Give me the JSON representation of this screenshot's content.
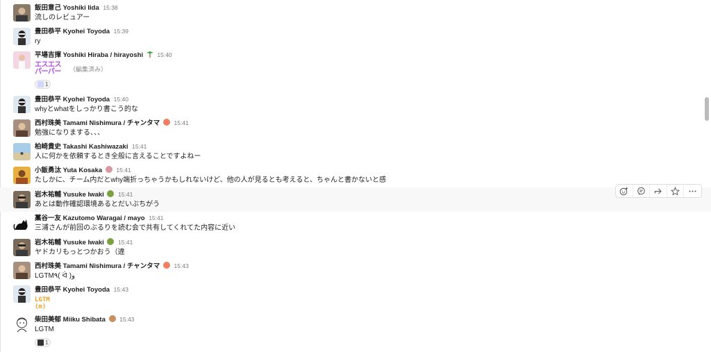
{
  "messages": [
    {
      "name": "飯田意己 Yoshiki Iida",
      "emoji": "",
      "time": "15:38",
      "text": "流しのレビュアー"
    },
    {
      "name": "豊田恭平 Kyohei Toyoda",
      "emoji": "",
      "time": "15:39",
      "text": "ry"
    },
    {
      "name": "平場吉揮 Yoshiki Hiraba / hirayoshi",
      "emoji": "palm-tree",
      "time": "15:40",
      "custom_emoji_lines": [
        "エスエス",
        "パーパー"
      ],
      "edited_label": "（編集済み）",
      "reaction_count": "1"
    },
    {
      "name": "豊田恭平 Kyohei Toyoda",
      "emoji": "",
      "time": "15:40",
      "text": "whyとwhatをしっかり書こう的な"
    },
    {
      "name": "西村珠美 Tamami Nishimura / チャンタマ",
      "emoji": "shrimp",
      "time": "15:41",
      "text": "勉強になりまする、、、"
    },
    {
      "name": "柏崎貴史 Takashi Kashiwazaki",
      "emoji": "",
      "time": "15:41",
      "text": "人に何かを依頼するとき全般に言えることですよねー"
    },
    {
      "name": "小飯勇汰 Yuta Kosaka",
      "emoji": "person",
      "time": "15:41",
      "text": "たしかに、チーム内だとwhy端折っちゃうかもしれないけど、他の人が見るとも考えると、ちゃんと書かないと感"
    },
    {
      "name": "岩木祐輔 Yusuke Iwaki",
      "emoji": "dinosaur",
      "time": "15:41",
      "text": "あとは動作確認環境あるとだいぶちがう"
    },
    {
      "name": "藁谷一友 Kazutomo Waragai / mayo",
      "emoji": "",
      "time": "15:41",
      "text": "三浦さんが前回のぶるりを読む会で共有してくれてた内容に近い"
    },
    {
      "name": "岩木祐輔 Yusuke Iwaki",
      "emoji": "dinosaur",
      "time": "15:41",
      "text": "ヤドカリもっとつかおう（違"
    },
    {
      "name": "西村珠美 Tamami Nishimura / チャンタマ",
      "emoji": "shrimp",
      "time": "15:43",
      "text": "LGTM٩( ᐛ )و"
    },
    {
      "name": "豊田恭平 Kyohei Toyoda",
      "emoji": "",
      "time": "15:43",
      "custom_emoji_lines": [
        "LGTM",
        "(m)"
      ]
    },
    {
      "name": "柴田美郁 Miiku Shibata",
      "emoji": "dog",
      "time": "15:43",
      "text": "LGTM",
      "reaction_count": "1"
    }
  ],
  "toolbar": {
    "icons": [
      "add-reaction-icon",
      "reply-thread-icon",
      "share-icon",
      "star-icon",
      "more-icon"
    ]
  },
  "colors": {
    "name": "#1d1c1d",
    "timestamp": "#7a7a7a",
    "hover_bg": "#f8f8f8",
    "custom_emoji_purple": "#b44fe0",
    "custom_emoji_orange": "#e8a224"
  }
}
